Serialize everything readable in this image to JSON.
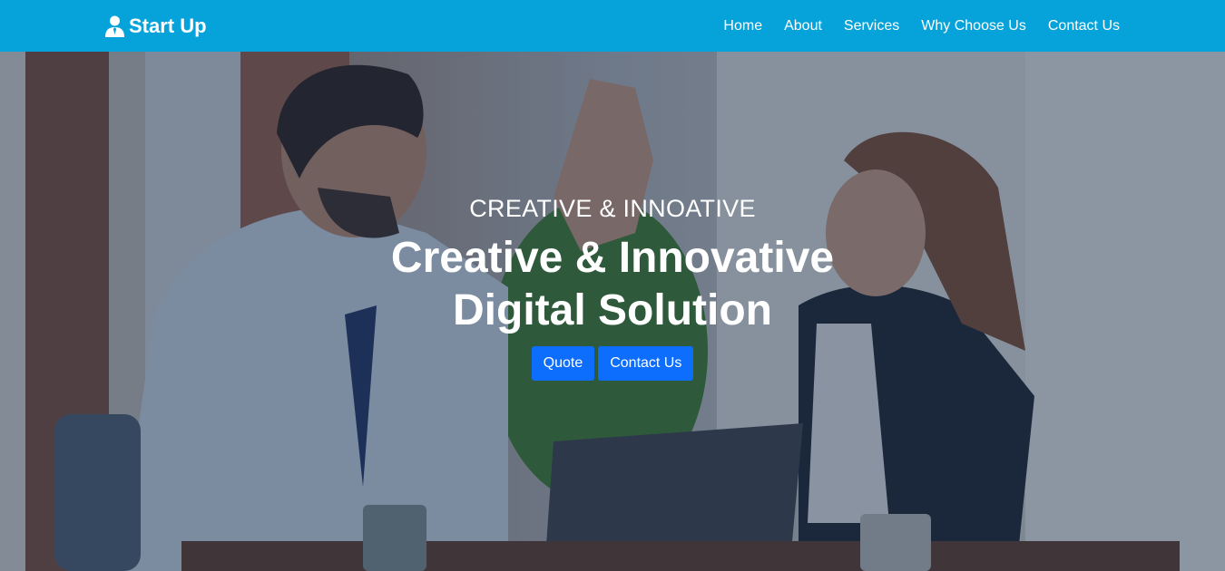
{
  "brand": {
    "name": "Start Up",
    "icon": "user-tie-icon"
  },
  "nav": {
    "items": [
      {
        "label": "Home"
      },
      {
        "label": "About"
      },
      {
        "label": "Services"
      },
      {
        "label": "Why Choose Us"
      },
      {
        "label": "Contact Us"
      }
    ]
  },
  "hero": {
    "subtitle": "CREATIVE & INNOATIVE",
    "title_line1": "Creative & Innovative",
    "title_line2": "Digital Solution",
    "buttons": {
      "quote": "Quote",
      "contact": "Contact Us"
    }
  },
  "colors": {
    "navbar": "#06a3da",
    "button": "#0d6efd",
    "text": "#ffffff"
  }
}
